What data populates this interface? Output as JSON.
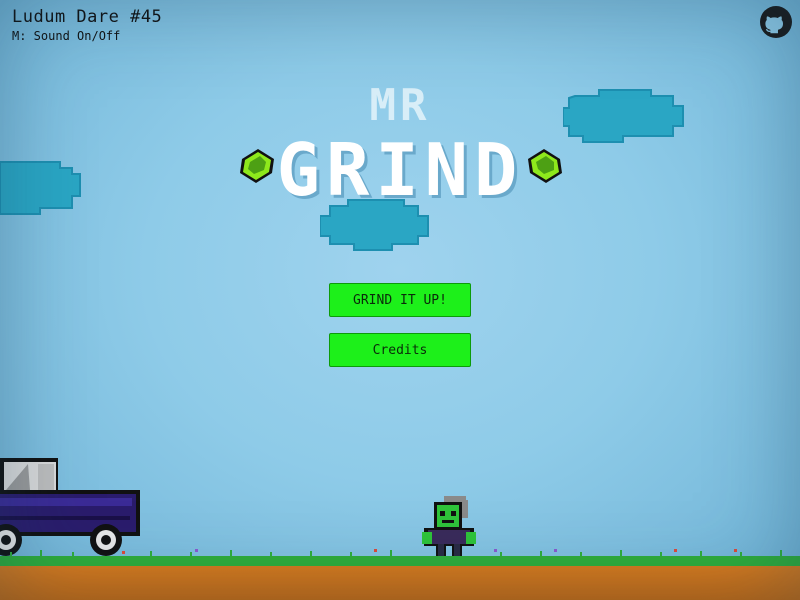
{
  "hud": {
    "title": "Ludum Dare #45",
    "sound_hint": "M: Sound On/Off"
  },
  "title": {
    "line1": "MR",
    "line2": "GRIND"
  },
  "menu": {
    "play_label": "GRIND IT UP!",
    "credits_label": "Credits"
  },
  "icons": {
    "github": "github-icon",
    "gem": "green-gem-icon"
  },
  "colors": {
    "sky": "#8ecbe8",
    "button": "#1df01a",
    "grass": "#2fae3a",
    "dirt": "#d87a1c",
    "cloud": "#2aa6c4"
  }
}
